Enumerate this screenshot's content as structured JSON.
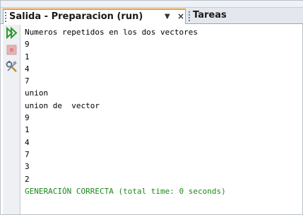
{
  "tabs": [
    {
      "label": "Salida - Preparacion (run)",
      "active": true
    },
    {
      "label": "Tareas",
      "active": false
    }
  ],
  "tab_controls": {
    "menu_glyph": "▼",
    "close_glyph": "×"
  },
  "toolbar": {
    "rerun": {
      "icon": "double-play-icon",
      "color": "#2a9a2a"
    },
    "stop": {
      "icon": "stop-icon",
      "color": "#c84a4a"
    },
    "settings": {
      "icon": "tools-icon"
    }
  },
  "output": {
    "lines": [
      {
        "text": "Numeros repetidos en los dos vectores",
        "type": "normal"
      },
      {
        "text": "9",
        "type": "normal"
      },
      {
        "text": "1",
        "type": "normal"
      },
      {
        "text": "4",
        "type": "normal"
      },
      {
        "text": "7",
        "type": "normal"
      },
      {
        "text": "union",
        "type": "normal"
      },
      {
        "text": "union de  vector",
        "type": "normal"
      },
      {
        "text": "9",
        "type": "normal"
      },
      {
        "text": "1",
        "type": "normal"
      },
      {
        "text": "4",
        "type": "normal"
      },
      {
        "text": "7",
        "type": "normal"
      },
      {
        "text": "3",
        "type": "normal"
      },
      {
        "text": "2",
        "type": "normal"
      },
      {
        "text": "GENERACIÓN CORRECTA (total time: 0 seconds)",
        "type": "success"
      }
    ],
    "success_color": "#1a8a1a"
  }
}
